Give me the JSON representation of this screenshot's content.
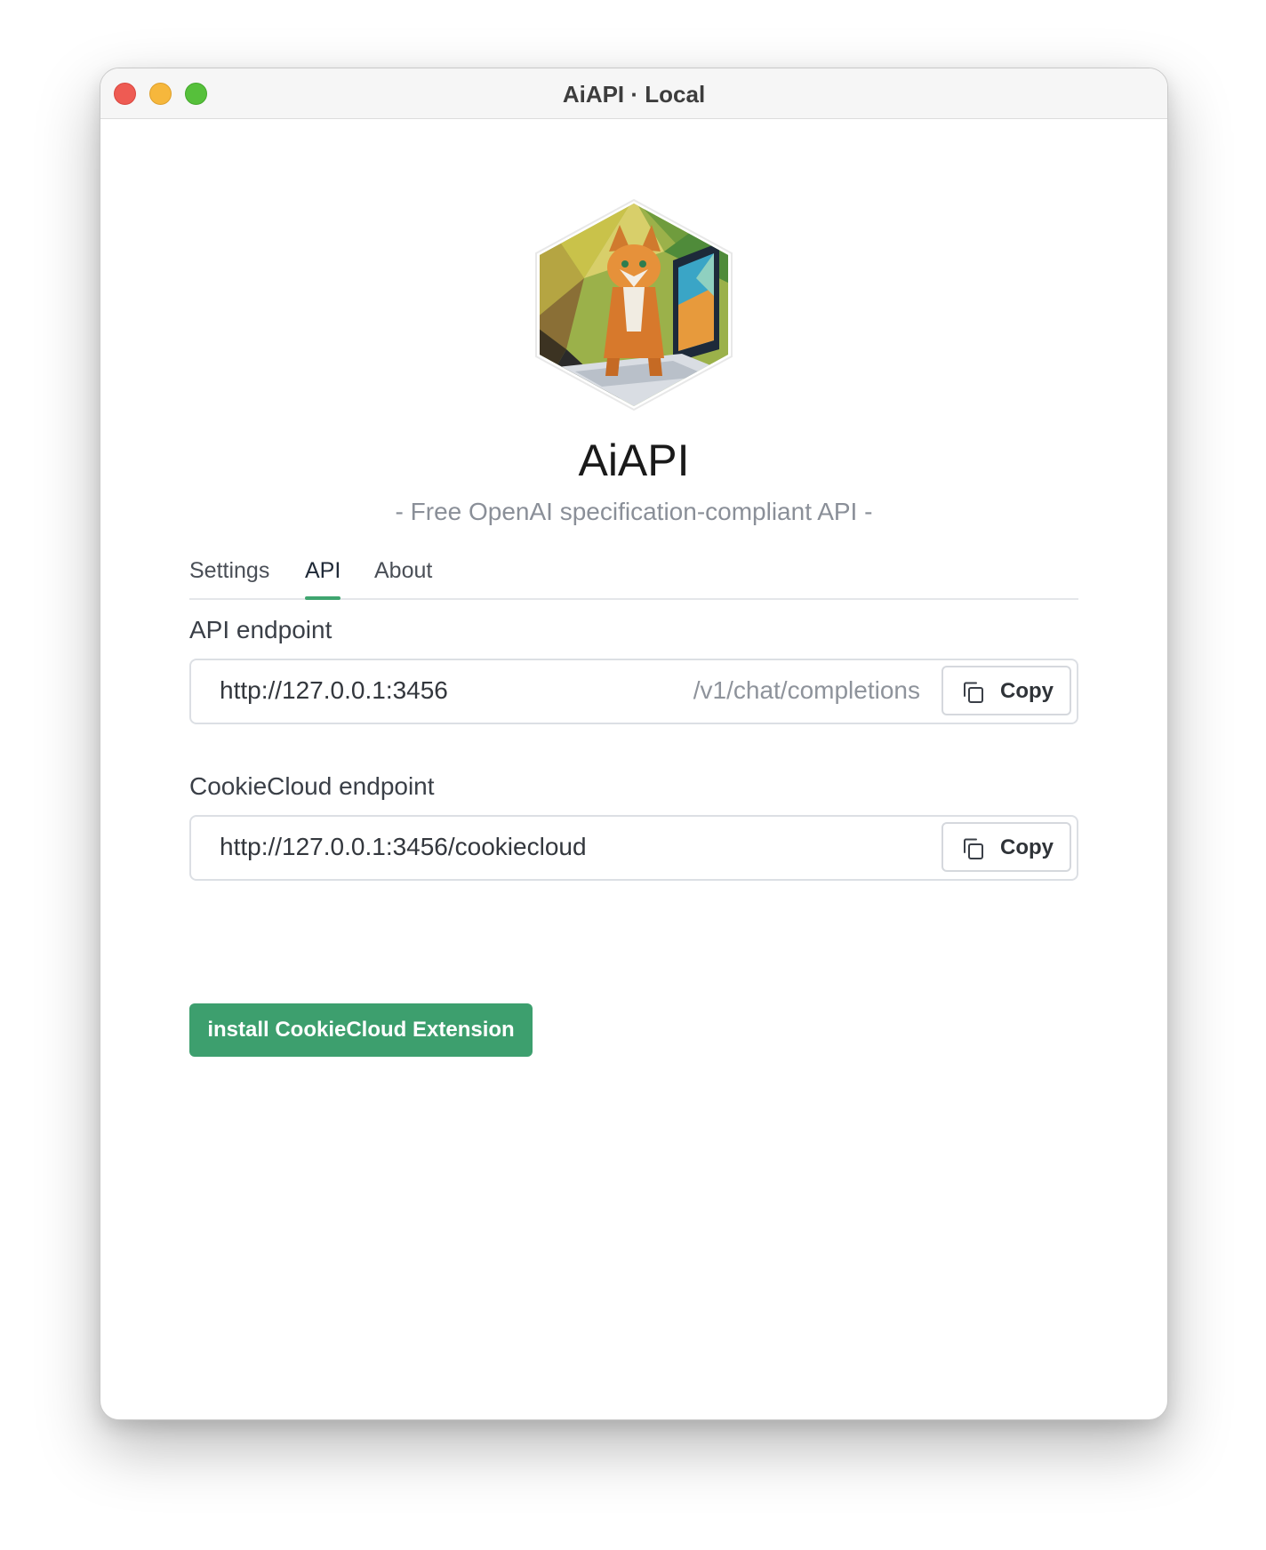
{
  "window": {
    "title": "AiAPI · Local"
  },
  "app": {
    "name": "AiAPI",
    "tagline": "- Free OpenAI specification-compliant API -",
    "logo_icon": "cat-computer-hexagon-logo"
  },
  "tabs": [
    {
      "label": "Settings",
      "active": false
    },
    {
      "label": "API",
      "active": true
    },
    {
      "label": "About",
      "active": false
    }
  ],
  "api_endpoint": {
    "label": "API endpoint",
    "value": "http://127.0.0.1:3456",
    "suffix": "/v1/chat/completions",
    "copy_label": "Copy",
    "copy_icon": "copy-icon"
  },
  "cookiecloud_endpoint": {
    "label": "CookieCloud endpoint",
    "value": "http://127.0.0.1:3456/cookiecloud",
    "copy_label": "Copy",
    "copy_icon": "copy-icon"
  },
  "install_button": {
    "label": "install CookieCloud Extension"
  },
  "colors": {
    "accent": "#3d9f6e",
    "close": "#ee5b53",
    "minimize": "#f6b73c",
    "maximize": "#56c03b"
  }
}
